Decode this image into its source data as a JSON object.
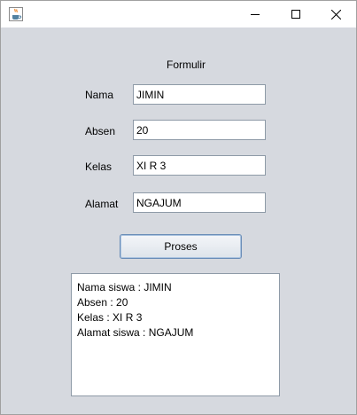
{
  "window": {
    "icon": "java-cup-icon",
    "controls": [
      "minimize-icon",
      "maximize-icon",
      "close-icon"
    ]
  },
  "form": {
    "heading": "Formulir",
    "fields": [
      {
        "label": "Nama",
        "value": "JIMIN"
      },
      {
        "label": "Absen",
        "value": "20"
      },
      {
        "label": "Kelas",
        "value": "XI R 3"
      },
      {
        "label": "Alamat",
        "value": "NGAJUM"
      }
    ],
    "button_label": "Proses"
  },
  "output": {
    "lines": [
      "Nama siswa : JIMIN",
      "Absen : 20",
      "Kelas : XI R 3",
      "Alamat siswa : NGAJUM"
    ]
  }
}
